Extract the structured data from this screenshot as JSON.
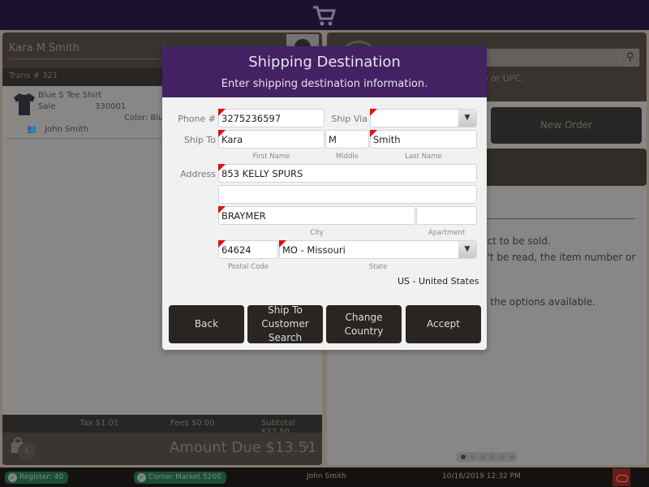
{
  "header": {
    "icon": "shopping-cart-icon"
  },
  "customer": {
    "name": "Kara M Smith"
  },
  "transaction": {
    "label": "Trans # 321",
    "item": {
      "name": "Blue S Tee Shirt",
      "type": "Sale",
      "sku": "330001",
      "attribute": "Color: Blue",
      "associate": "John Smith"
    },
    "totals": {
      "tax": "Tax $1.01",
      "fees": "Fees $0.00",
      "subtotal": "Subtotal $12.50"
    },
    "amount_due": "Amount Due  $13.51",
    "bag_count": "1"
  },
  "right_panel": {
    "scan_hint": "D or UPC.",
    "new_order": "New Order",
    "help": [
      "uct to be sold.",
      "n't be read, the item number or",
      ".",
      "n the options available."
    ],
    "pager": {
      "pages": 6,
      "active": 1
    }
  },
  "modal": {
    "title": "Shipping Destination",
    "subtitle": "Enter shipping destination information.",
    "labels": {
      "phone": "Phone #",
      "ship_via": "Ship Via",
      "ship_to": "Ship To",
      "address": "Address",
      "first_name": "First Name",
      "middle": "Middle",
      "last_name": "Last Name",
      "city": "City",
      "apartment": "Apartment",
      "postal_code": "Postal Code",
      "state": "State"
    },
    "values": {
      "phone": "3275236597",
      "ship_via": "",
      "first_name": "Kara",
      "middle": "M",
      "last_name": "Smith",
      "address1": "853 KELLY SPURS",
      "address2": "",
      "city": "BRAYMER",
      "apartment": "",
      "postal_code": "64624",
      "state": "MO - Missouri"
    },
    "country": "US - United States",
    "buttons": {
      "back": "Back",
      "customer_search": "Ship To\nCustomer\nSearch",
      "change_country": "Change\nCountry",
      "accept": "Accept"
    }
  },
  "status_bar": {
    "register": "Register: 40",
    "store": "Corner Market 5200",
    "user": "John Smith",
    "datetime": "10/16/2019 12:32 PM"
  }
}
